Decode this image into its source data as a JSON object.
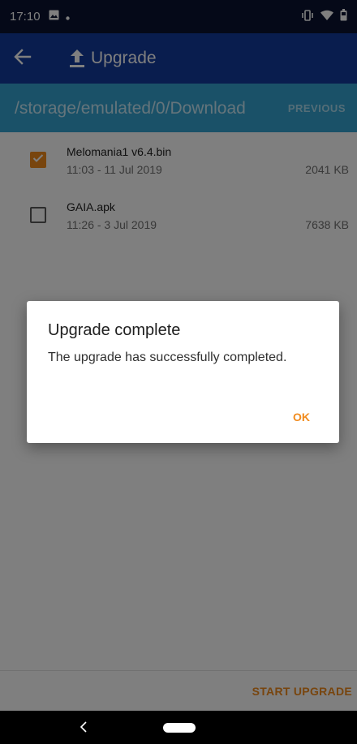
{
  "status_bar": {
    "time": "17:10",
    "left_icons": [
      "image-icon",
      "dot-icon"
    ],
    "right_icons": [
      "vibrate-icon",
      "wifi-icon",
      "battery-icon"
    ]
  },
  "app_bar": {
    "title": "Upgrade",
    "back_icon": "arrow-left-icon",
    "title_icon": "upload-icon",
    "color": "#133a9c"
  },
  "path_bar": {
    "path": "/storage/emulated/0/Download",
    "previous_label": "PREVIOUS",
    "color": "#35a3d0"
  },
  "files": [
    {
      "name": "Melomania1 v6.4.bin",
      "date": "11:03 - 11 Jul 2019",
      "size": "2041 KB",
      "checked": true
    },
    {
      "name": "GAIA.apk",
      "date": "11:26 - 3 Jul 2019",
      "size": "7638 KB",
      "checked": false
    }
  ],
  "bottom_bar": {
    "start_upgrade_label": "START UPGRADE",
    "accent": "#f18b1d"
  },
  "dialog": {
    "title": "Upgrade complete",
    "message": "The upgrade has successfully completed.",
    "ok_label": "OK"
  }
}
